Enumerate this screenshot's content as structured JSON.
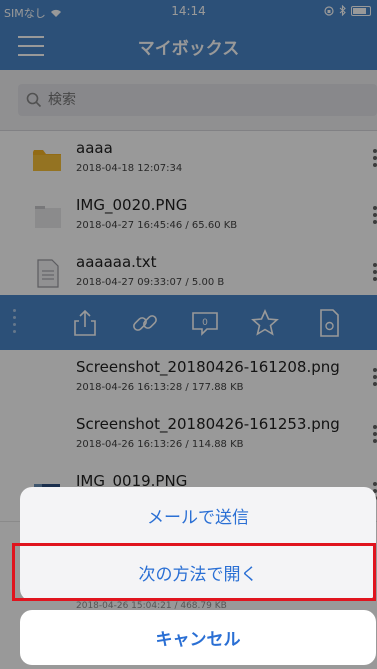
{
  "status": {
    "carrier": "SIMなし",
    "time": "14:14"
  },
  "header": {
    "title": "マイボックス"
  },
  "search": {
    "placeholder": "検索"
  },
  "files": [
    {
      "name": "aaaa",
      "meta": "2018-04-18 12:07:34",
      "icon": "folder-icon"
    },
    {
      "name": "IMG_0020.PNG",
      "meta": "2018-04-27 16:45:46 / 65.60 KB",
      "icon": "image-file-icon"
    },
    {
      "name": "aaaaaa.txt",
      "meta": "2018-04-27 09:33:07 / 5.00 B",
      "icon": "text-file-icon"
    },
    {
      "name": "Screenshot_20180426-161208.png",
      "meta": "2018-04-26 16:13:28 / 177.88 KB"
    },
    {
      "name": "Screenshot_20180426-161253.png",
      "meta": "2018-04-26 16:13:26 / 114.88 KB"
    },
    {
      "name": "IMG_0019.PNG",
      "meta": ""
    }
  ],
  "actions": [
    "share-icon",
    "link-icon",
    "comment-icon",
    "star-icon",
    "file-settings-icon"
  ],
  "comment_count": "0",
  "sheet": {
    "email": "メールで送信",
    "open_with": "次の方法で開く",
    "cancel": "キャンセル",
    "behind_meta": "2018-04-26 15:04:21 / 468.79 KB"
  },
  "colors": {
    "header": "#4a86c8",
    "action_text": "#2a6fd4",
    "highlight": "#e0141e"
  }
}
